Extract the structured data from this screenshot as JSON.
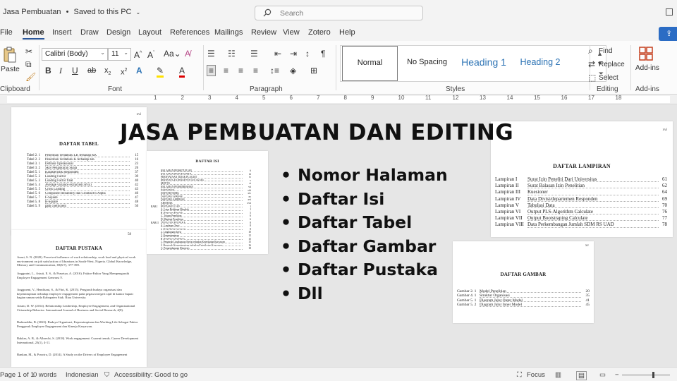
{
  "titlebar": {
    "doc_name": "Jasa Pembuatan",
    "save_state": "Saved to this PC",
    "search_placeholder": "Search"
  },
  "menu": [
    "File",
    "Home",
    "Insert",
    "Draw",
    "Design",
    "Layout",
    "References",
    "Mailings",
    "Review",
    "View",
    "Zotero",
    "Help"
  ],
  "menu_active": "Home",
  "ribbon": {
    "clipboard": {
      "paste": "Paste",
      "label": "Clipboard"
    },
    "font": {
      "name": "Calibri (Body)",
      "size": "11",
      "label": "Font"
    },
    "paragraph": {
      "label": "Paragraph"
    },
    "styles": {
      "items": [
        "Normal",
        "No Spacing",
        "Heading 1",
        "Heading 2"
      ],
      "selected": "Normal",
      "label": "Styles"
    },
    "editing": {
      "find": "Find",
      "replace": "Replace",
      "select": "Select",
      "label": "Editing"
    },
    "addins": {
      "button": "Add-ins",
      "label": "Add-ins"
    }
  },
  "ruler_numbers": [
    "1",
    "2",
    "3",
    "4",
    "5",
    "6",
    "7",
    "8",
    "9",
    "10",
    "11",
    "12",
    "13",
    "14",
    "15",
    "16",
    "17",
    "18"
  ],
  "overlay": {
    "title": "JASA PEMBUATAN DAN EDITING",
    "bullets": [
      "Nomor Halaman",
      "Daftar Isi",
      "Daftar Tabel",
      "Daftar Gambar",
      "Daftar Pustaka",
      "Dll"
    ]
  },
  "pages": {
    "daftar_tabel": {
      "page_no": "xvi",
      "heading": "DAFTAR TABEL",
      "rows": [
        {
          "label": "Tabel 2. 1",
          "title": "Penelitian Terdahulu LK terhadap KK",
          "page": "15"
        },
        {
          "label": "Tabel 2. 2",
          "title": "Penelitian Terdahulu K terhadap KK",
          "page": "16"
        },
        {
          "label": "Tabel 3. 1",
          "title": "Definisi Operasional",
          "page": "23"
        },
        {
          "label": "Tabel 3. 2",
          "title": "Skor Pengukuran Skala",
          "page": "26"
        },
        {
          "label": "Tabel 5. 1",
          "title": "Karakteristik Responden",
          "page": "37"
        },
        {
          "label": "Tabel 5. 2",
          "title": "Loading Factor",
          "page": "39"
        },
        {
          "label": "Tabel 5. 3",
          "title": "Loading Factor final",
          "page": "40"
        },
        {
          "label": "Tabel 5. 4",
          "title": "Average variance extracted (AVE)",
          "page": "42"
        },
        {
          "label": "Tabel 5. 5",
          "title": "Cross Loading",
          "page": "43"
        },
        {
          "label": "Tabel 5. 6",
          "title": "Composite Reliability dan Cronbach's Alpha",
          "page": "46"
        },
        {
          "label": "Tabel 5. 7",
          "title": "F-Square",
          "page": "47"
        },
        {
          "label": "Tabel 5. 8",
          "title": "R-Square",
          "page": "48"
        },
        {
          "label": "Tabel 5. 9",
          "title": "path coefficient",
          "page": "50"
        }
      ]
    },
    "daftar_pustaka": {
      "page_no": "58",
      "heading": "DAFTAR PUSTAKA",
      "refs": [
        "Anasi, S. N. (2020). Perceived influence of work relationship, work load and physical work environment on job satisfaction of librarians in South-West, Nigeria. Global Knowledge, Memory and Communication, 69(6/7), 377-398.",
        "Anggraini, L., Astuti, E. S., & Prasetya, A. (2016). Faktor-Faktor Yang Mempengaruhi Employee Engagement Generasi Y.",
        "Anggraeni, V., Hendriani, S., & Fitri, K. (2015). Pengaruh budaya organisasi dan kepemimpinan terhadap employee engagement pada pegawai negeri sipil di kantor bupati bagian umum setda Kabupaten Siak. Riau University.",
        "Ariani, D. W. (2014). Relationship Leadership, Employee Engagement, and Organizational Citizenship Behavior. International Journal of Business and Social Research, 4(8).",
        "Badaruddin, B. (2022). Budaya Organisasi, Kepemimpinan dan Working Life Sebagai Faktor Penggerak Employee Engagement dan Kinerja Karyawan.",
        "Bakker, A. B., & Albrecht, S. (2018). Work engagement: Current trends. Career Development International, 23(1), 4-11.",
        "Bankan, M., & Prawira, D. (2014). A Study on the Drivers of Employee Engagement"
      ]
    },
    "daftar_isi": {
      "heading": "DAFTAR ISI",
      "rows": [
        {
          "label": "",
          "title": "HALAMAN PERSETUJUAN",
          "page": "ii"
        },
        {
          "label": "",
          "title": "HALAMAN PENGESAHAN",
          "page": "iii"
        },
        {
          "label": "",
          "title": "PERNYATAAN TIDAK PLAGIAT",
          "page": "iv"
        },
        {
          "label": "",
          "title": "PERNYATAAN PERSETUJUAN AKSES",
          "page": "v"
        },
        {
          "label": "",
          "title": "MOTTO",
          "page": "vi"
        },
        {
          "label": "",
          "title": "HALAMAN PERSEMBAHAN",
          "page": "vii"
        },
        {
          "label": "",
          "title": "DAFTAR ISI",
          "page": "viii"
        },
        {
          "label": "",
          "title": "DAFTAR TABEL",
          "page": "xiv"
        },
        {
          "label": "",
          "title": "DAFTAR GAMBAR",
          "page": "xv"
        },
        {
          "label": "",
          "title": "DAFTAR LAMPIRAN",
          "page": "xvi"
        },
        {
          "label": "",
          "title": "ABSTRAK",
          "page": "xvii"
        },
        {
          "label": "BAB I",
          "title": "PENDAHULUAN",
          "page": "1"
        },
        {
          "label": "",
          "title": "A. Latar Belakang Masalah",
          "page": "1"
        },
        {
          "label": "",
          "title": "B. Rumusan Masalah",
          "page": "5"
        },
        {
          "label": "",
          "title": "C. Tujuan Penelitian",
          "page": "6"
        },
        {
          "label": "",
          "title": "D. Manfaat Penelitian",
          "page": "6"
        },
        {
          "label": "BAB II",
          "title": "TINJAUAN PUSTAKA",
          "page": "8"
        },
        {
          "label": "",
          "title": "A. Landasan Teori",
          "page": "8"
        },
        {
          "label": "",
          "title": "1. Keterikatan karyawan",
          "page": "8"
        },
        {
          "label": "",
          "title": "2. Lingkungan kerja",
          "page": "10"
        },
        {
          "label": "",
          "title": "3. Kepemimpinan",
          "page": "12"
        },
        {
          "label": "",
          "title": "B. Penelitian Terdahulu",
          "page": "15"
        },
        {
          "label": "",
          "title": "1. Pengaruh Lingkungan Kerja terhadap Keterikatan Karyawan",
          "page": "15"
        },
        {
          "label": "",
          "title": "2. Pengaruh Kepemimpinan terhadap Keterikatan Karyawan",
          "page": "16"
        },
        {
          "label": "",
          "title": "C. Pengembangan Hipotesis",
          "page": "18"
        }
      ]
    },
    "daftar_lampiran": {
      "page_no": "xvi",
      "heading": "DAFTAR LAMPIRAN",
      "rows": [
        {
          "label": "Lampiran I",
          "title": "Surat Izin Peneliti Dari Universitas",
          "page": "61"
        },
        {
          "label": "Lampiran II",
          "title": "Surat Balasan Izin Penelitian",
          "page": "62"
        },
        {
          "label": "Lampiran III",
          "title": "Kuesioner",
          "page": "64"
        },
        {
          "label": "Lampiran IV",
          "title": "Data Divisi/departemen Responden",
          "page": "69"
        },
        {
          "label": "Lampiran V",
          "title": "Tabulasi Data",
          "page": "70"
        },
        {
          "label": "Lampiran VI",
          "title": "Output PLS-Algorithm Calculate",
          "page": "76"
        },
        {
          "label": "Lampiran VII",
          "title": "Output Bootstraping Calculate",
          "page": "77"
        },
        {
          "label": "Lampiran VIII",
          "title": "Data Perkembangan Jumlah SDM RS UAD",
          "page": "78"
        }
      ]
    },
    "daftar_gambar": {
      "page_no": "xv",
      "heading": "DAFTAR GAMBAR",
      "rows": [
        {
          "label": "Gambar 2. 1",
          "title": "Model Penelitian",
          "page": "20"
        },
        {
          "label": "Gambar 4. 1",
          "title": "Struktur Organisasi",
          "page": "35"
        },
        {
          "label": "Gambar 5. 1",
          "title": "Diagram Jalur Outer Model",
          "page": "41"
        },
        {
          "label": "Gambar 5. 2",
          "title": "Diagram Jalur Inner Model",
          "page": "45"
        }
      ]
    }
  },
  "statusbar": {
    "page": "Page 1 of 1",
    "words": "0 words",
    "language": "Indonesian",
    "accessibility": "Accessibility: Good to go",
    "focus": "Focus"
  }
}
